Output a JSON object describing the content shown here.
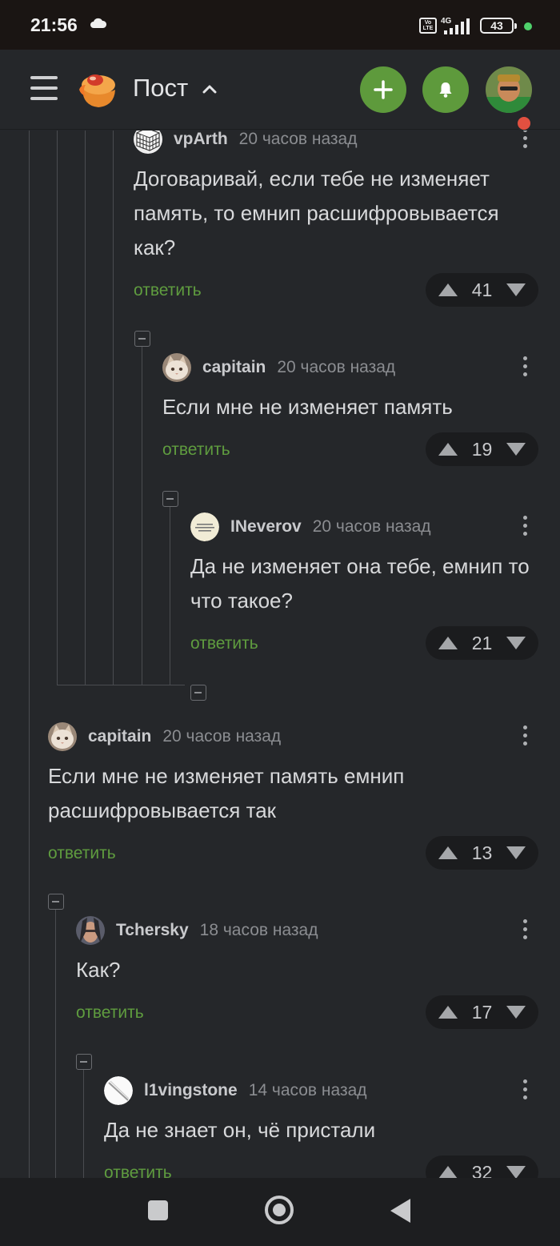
{
  "status_bar": {
    "time": "21:56",
    "battery": "43",
    "network": "4G",
    "volte": "Vo LTE"
  },
  "header": {
    "title": "Пост"
  },
  "comments": [
    {
      "user": "vpArth",
      "time": "20 часов назад",
      "text": "Договаривай, если тебе не изменяет память, то емнип расшифровывается как?",
      "reply": "ответить",
      "score": "41"
    },
    {
      "user": "capitain",
      "time": "20 часов назад",
      "text": "Если мне не изменяет память",
      "reply": "ответить",
      "score": "19"
    },
    {
      "user": "INeverov",
      "time": "20 часов назад",
      "text": "Да не изменяет она тебе, емнип то что такое?",
      "reply": "ответить",
      "score": "21"
    },
    {
      "user": "capitain",
      "time": "20 часов назад",
      "text": "Если мне не изменяет память емнип расшифровывается так",
      "reply": "ответить",
      "score": "13"
    },
    {
      "user": "Tchersky",
      "time": "18 часов назад",
      "text": "Как?",
      "reply": "ответить",
      "score": "17"
    },
    {
      "user": "l1vingstone",
      "time": "14 часов назад",
      "text": "Да не знает он, чё пристали",
      "reply": "ответить",
      "score": "32"
    }
  ],
  "colors": {
    "background": "#25272a",
    "accent_green": "#5e9a3c",
    "reply_link": "#5f9c3f",
    "notification_badge": "#e25040"
  }
}
